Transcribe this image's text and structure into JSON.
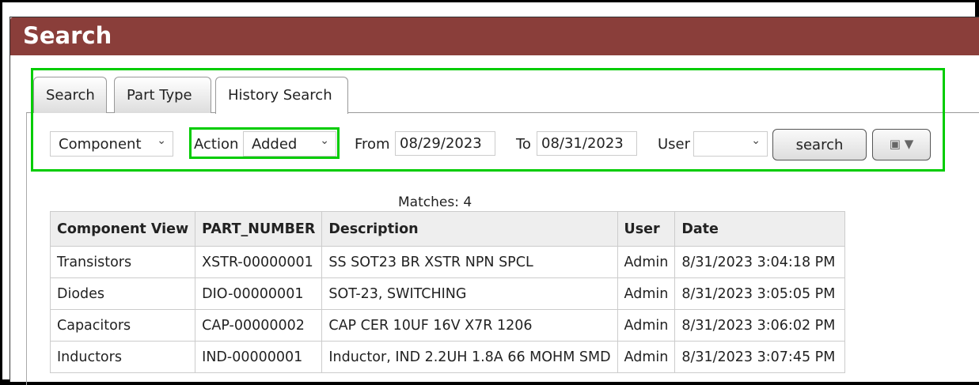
{
  "header": {
    "title": "Search"
  },
  "tabs": [
    {
      "label": "Search"
    },
    {
      "label": "Part Type"
    },
    {
      "label": "History Search",
      "active": true
    }
  ],
  "filters": {
    "type": "Component",
    "action_label": "Action",
    "action": "Added",
    "from_label": "From",
    "from": "08/29/2023",
    "to_label": "To",
    "to": "08/31/2023",
    "user_label": "User",
    "user": "",
    "search_label": "search",
    "save_icon": "save-icon"
  },
  "results": {
    "matches": "Matches: 4",
    "columns": [
      "Component View",
      "PART_NUMBER",
      "Description",
      "User",
      "Date"
    ],
    "rows": [
      [
        "Transistors",
        "XSTR-00000001",
        "SS SOT23 BR XSTR NPN SPCL",
        "Admin",
        "8/31/2023 3:04:18 PM"
      ],
      [
        "Diodes",
        "DIO-00000001",
        "SOT-23, SWITCHING",
        "Admin",
        "8/31/2023 3:05:05 PM"
      ],
      [
        "Capacitors",
        "CAP-00000002",
        "CAP CER 10UF 16V X7R 1206",
        "Admin",
        "8/31/2023 3:06:02 PM"
      ],
      [
        "Inductors",
        "IND-00000001",
        "Inductor, IND 2.2UH 1.8A 66 MOHM SMD",
        "Admin",
        "8/31/2023 3:07:45 PM"
      ]
    ]
  },
  "colors": {
    "header": "#8a3e3a",
    "highlight": "#00cc00"
  }
}
